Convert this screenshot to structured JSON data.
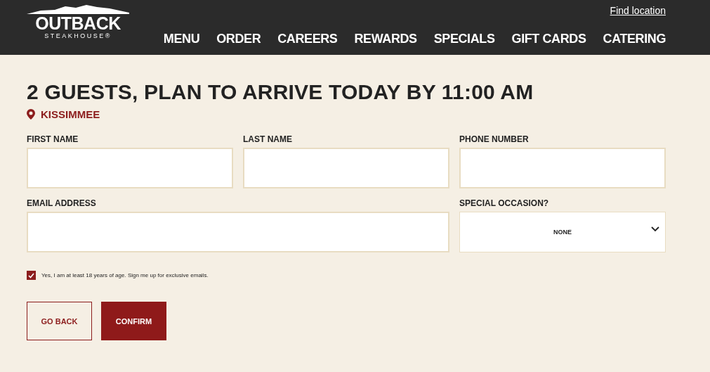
{
  "header": {
    "logo": {
      "name": "OUTBACK",
      "tagline": "STEAKHOUSE®"
    },
    "find_location": "Find location",
    "nav": [
      "MENU",
      "ORDER",
      "CAREERS",
      "REWARDS",
      "SPECIALS",
      "GIFT CARDS",
      "CATERING"
    ]
  },
  "form": {
    "title": "2 GUESTS, PLAN TO ARRIVE TODAY BY 11:00 AM",
    "location": "KISSIMMEE",
    "fields": [
      {
        "kind": "text",
        "label": "FIRST NAME"
      },
      {
        "kind": "text",
        "label": "LAST NAME"
      },
      {
        "kind": "text",
        "label": "PHONE NUMBER"
      },
      {
        "kind": "email",
        "label": "EMAIL ADDRESS"
      },
      {
        "kind": "select",
        "label": "SPECIAL OCCASION?",
        "value": "NONE"
      }
    ],
    "consent": {
      "checked": true,
      "label": "Yes, I am at least 18 years of age. Sign me up for exclusive emails."
    },
    "buttons": [
      {
        "kind": "secondary",
        "label": "GO BACK"
      },
      {
        "kind": "primary",
        "label": "CONFIRM"
      }
    ]
  }
}
